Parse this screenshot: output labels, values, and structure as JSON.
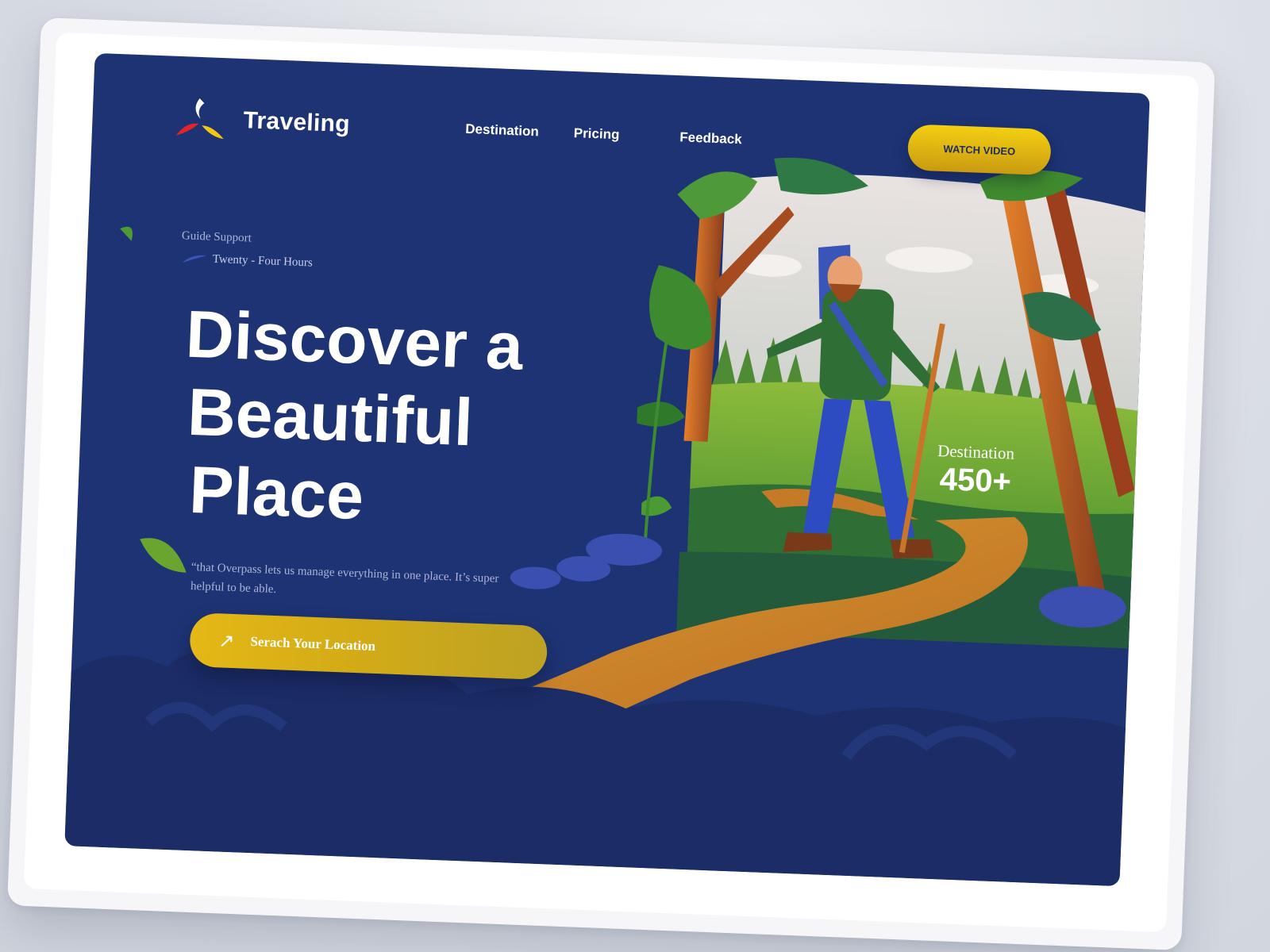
{
  "brand": {
    "name": "Traveling",
    "icon": "flame-leaf-logo"
  },
  "nav": {
    "items": [
      {
        "label": "Destination"
      },
      {
        "label": "Pricing"
      },
      {
        "label": "Feedback"
      }
    ],
    "cta_label": "WATCH VIDEO"
  },
  "hero": {
    "eyebrow": "Guide Support",
    "hours_label": "Twenty - Four Hours",
    "headline": [
      "Discover a",
      "Beautiful",
      "Place"
    ],
    "quote": "“that Overpass lets us manage everything in one place. It’s super helpful to be able.",
    "search_label": "Serach Your Location",
    "search_icon": "arrow-up-right-icon"
  },
  "stats": {
    "title": "Destination",
    "value": "450+"
  },
  "colors": {
    "screen_bg": "#1e3374",
    "accent_yellow": "#e4b816",
    "path_orange": "#d98a2a",
    "foliage_green": "#3e8a2e"
  }
}
